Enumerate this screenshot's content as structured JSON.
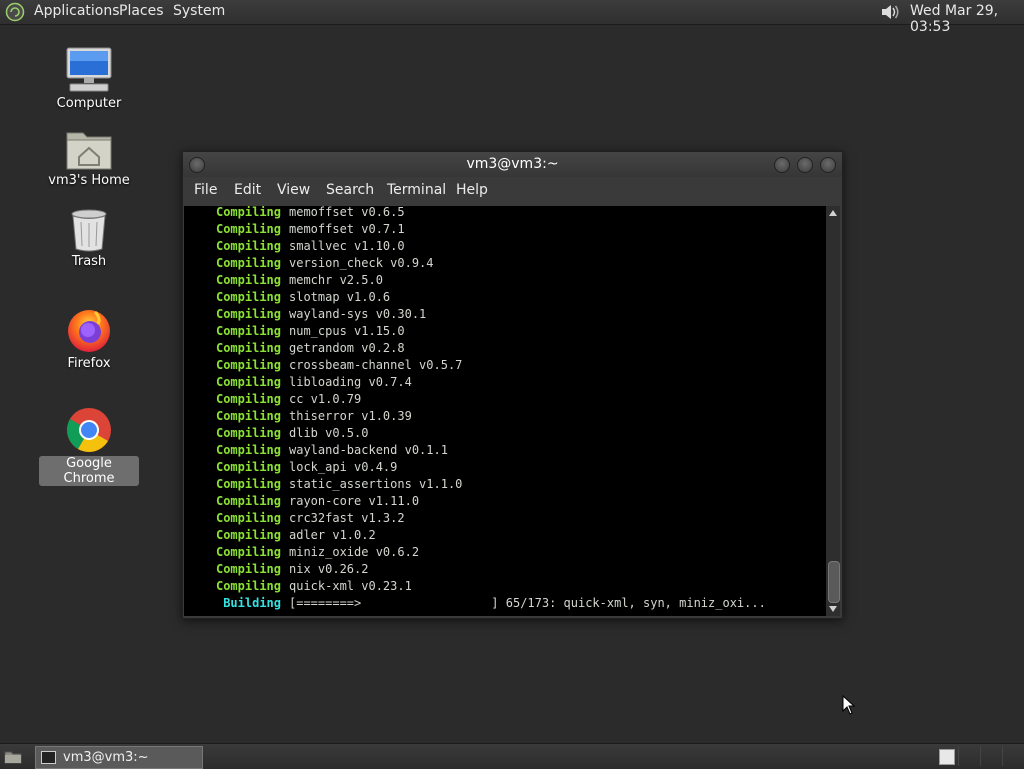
{
  "top_panel": {
    "menus": [
      "Applications",
      "Places",
      "System"
    ],
    "clock": "Wed Mar 29, 03:53"
  },
  "desktop": {
    "icons": [
      {
        "label": "Computer"
      },
      {
        "label": "vm3's Home"
      },
      {
        "label": "Trash"
      },
      {
        "label": "Firefox"
      },
      {
        "label": "Google Chrome"
      }
    ]
  },
  "terminal": {
    "title": "vm3@vm3:~",
    "menu": [
      "File",
      "Edit",
      "View",
      "Search",
      "Terminal",
      "Help"
    ],
    "lines": [
      {
        "keyword": "Compiling",
        "text": "memoffset v0.6.5"
      },
      {
        "keyword": "Compiling",
        "text": "memoffset v0.7.1"
      },
      {
        "keyword": "Compiling",
        "text": "smallvec v1.10.0"
      },
      {
        "keyword": "Compiling",
        "text": "version_check v0.9.4"
      },
      {
        "keyword": "Compiling",
        "text": "memchr v2.5.0"
      },
      {
        "keyword": "Compiling",
        "text": "slotmap v1.0.6"
      },
      {
        "keyword": "Compiling",
        "text": "wayland-sys v0.30.1"
      },
      {
        "keyword": "Compiling",
        "text": "num_cpus v1.15.0"
      },
      {
        "keyword": "Compiling",
        "text": "getrandom v0.2.8"
      },
      {
        "keyword": "Compiling",
        "text": "crossbeam-channel v0.5.7"
      },
      {
        "keyword": "Compiling",
        "text": "libloading v0.7.4"
      },
      {
        "keyword": "Compiling",
        "text": "cc v1.0.79"
      },
      {
        "keyword": "Compiling",
        "text": "thiserror v1.0.39"
      },
      {
        "keyword": "Compiling",
        "text": "dlib v0.5.0"
      },
      {
        "keyword": "Compiling",
        "text": "wayland-backend v0.1.1"
      },
      {
        "keyword": "Compiling",
        "text": "lock_api v0.4.9"
      },
      {
        "keyword": "Compiling",
        "text": "static_assertions v1.1.0"
      },
      {
        "keyword": "Compiling",
        "text": "rayon-core v1.11.0"
      },
      {
        "keyword": "Compiling",
        "text": "crc32fast v1.3.2"
      },
      {
        "keyword": "Compiling",
        "text": "adler v1.0.2"
      },
      {
        "keyword": "Compiling",
        "text": "miniz_oxide v0.6.2"
      },
      {
        "keyword": "Compiling",
        "text": "nix v0.26.2"
      },
      {
        "keyword": "Compiling",
        "text": "quick-xml v0.23.1"
      }
    ],
    "status": {
      "keyword": "Building",
      "text": "[========>                  ] 65/173: quick-xml, syn, miniz_oxi..."
    },
    "colors": {
      "compiling": "#8ae234",
      "building": "#34e2e2",
      "text": "#d3d7cf"
    }
  },
  "taskbar": {
    "tasks": [
      {
        "label": "vm3@vm3:~"
      }
    ]
  },
  "icons": [
    "mate-logo-icon",
    "volume-icon",
    "computer-icon",
    "home-folder-icon",
    "trash-icon",
    "firefox-icon",
    "chrome-icon",
    "terminal-icon",
    "show-desktop-icon",
    "mouse-cursor-icon"
  ]
}
